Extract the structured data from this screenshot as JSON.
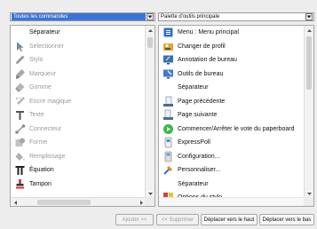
{
  "left_combo": {
    "value": "Toutes les commandes"
  },
  "right_combo": {
    "value": "Palette d'outils principale"
  },
  "left_list": {
    "items": [
      {
        "label": "Séparateur",
        "icon": "separator-icon",
        "enabled": true
      },
      {
        "label": "Sélectionner",
        "icon": "arrow-cursor-icon",
        "enabled": false
      },
      {
        "label": "Stylo",
        "icon": "pen-icon",
        "enabled": false
      },
      {
        "label": "Marqueur",
        "icon": "marker-icon",
        "enabled": false
      },
      {
        "label": "Gomme",
        "icon": "eraser-icon",
        "enabled": false
      },
      {
        "label": "Encre magique",
        "icon": "magic-ink-icon",
        "enabled": false
      },
      {
        "label": "Texte",
        "icon": "text-icon",
        "enabled": false
      },
      {
        "label": "Connecteur",
        "icon": "connector-icon",
        "enabled": false
      },
      {
        "label": "Forme",
        "icon": "shape-icon",
        "enabled": false
      },
      {
        "label": "Remplissage",
        "icon": "fill-icon",
        "enabled": false
      },
      {
        "label": "Équation",
        "icon": "equation-icon",
        "enabled": true
      },
      {
        "label": "Tampon",
        "icon": "stamp-icon",
        "enabled": true
      }
    ]
  },
  "right_list": {
    "items": [
      {
        "label": "Menu : Menu principal",
        "icon": "menu-icon"
      },
      {
        "label": "Changer de profil",
        "icon": "profile-icon"
      },
      {
        "label": "Annotation de bureau",
        "icon": "desktop-annotation-icon"
      },
      {
        "label": "Outils de bureau",
        "icon": "desktop-tools-icon"
      },
      {
        "label": "Séparateur",
        "icon": ""
      },
      {
        "label": "Page précédente",
        "icon": "previous-page-icon"
      },
      {
        "label": "Page suivante",
        "icon": "next-page-icon"
      },
      {
        "label": "Commencer/Arrêter le vote du paperboard",
        "icon": "vote-icon"
      },
      {
        "label": "ExpressPoll",
        "icon": "expresspoll-icon"
      },
      {
        "label": "Configuration...",
        "icon": "configuration-icon"
      },
      {
        "label": "Personnaliser...",
        "icon": "customize-icon"
      },
      {
        "label": "Séparateur",
        "icon": ""
      },
      {
        "label": "Options du stylo",
        "icon": "pen-options-icon"
      }
    ]
  },
  "buttons": {
    "add": "Ajouter >>",
    "remove": "<< Supprimer",
    "move_up": "Déplacer vers le haut",
    "move_down": "Déplacer vers le bas"
  },
  "colors": {
    "selection": "#3a74d8",
    "disabled_text": "#9a9a9a"
  }
}
